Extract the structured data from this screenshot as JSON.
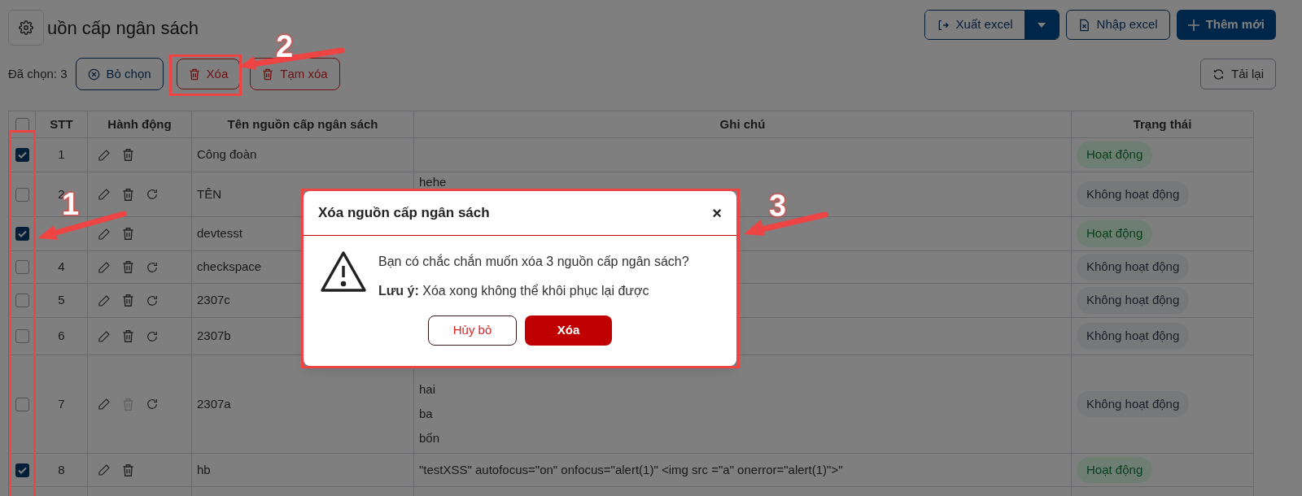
{
  "page": {
    "title": "uồn cấp ngân sách"
  },
  "toolbar": {
    "export": "Xuất excel",
    "import": "Nhập excel",
    "add": "Thêm mới",
    "reload": "Tải lại"
  },
  "selection": {
    "count_label": "Đã chọn: 3",
    "buttons": [
      {
        "label": "Bỏ chọn",
        "kind": "clear"
      },
      {
        "label": "Xóa",
        "kind": "delete"
      },
      {
        "label": "Tạm xóa",
        "kind": "soft-delete"
      }
    ]
  },
  "table": {
    "header_checked": false,
    "columns": [
      "STT",
      "Hành động",
      "Tên nguồn cấp ngân sách",
      "Ghi chú",
      "Trạng thái"
    ],
    "rows": [
      {
        "checked": true,
        "stt": "1",
        "name": "Công đoàn",
        "can_restore": false,
        "delete_disabled": false,
        "status": {
          "label": "Hoạt động",
          "active": true
        }
      },
      {
        "checked": false,
        "stt": "2",
        "name": "TÊN",
        "note": [
          "hehe"
        ],
        "can_restore": true,
        "delete_disabled": false,
        "status": {
          "label": "Không hoạt động",
          "active": false
        }
      },
      {
        "checked": true,
        "name": "devtesst",
        "can_restore": false,
        "delete_disabled": false,
        "status": {
          "label": "Hoạt động",
          "active": true
        }
      },
      {
        "checked": false,
        "stt": "4",
        "name": "checkspace",
        "can_restore": true,
        "delete_disabled": false,
        "status": {
          "label": "Không hoạt động",
          "active": false
        }
      },
      {
        "checked": false,
        "stt": "5",
        "name": "2307c",
        "can_restore": true,
        "delete_disabled": false,
        "status": {
          "label": "Không hoạt động",
          "active": false
        }
      },
      {
        "checked": false,
        "stt": "6",
        "name": "2307b",
        "can_restore": true,
        "delete_disabled": false,
        "status": {
          "label": "Không hoạt động",
          "active": false
        }
      },
      {
        "checked": false,
        "stt": "7",
        "name": "2307a",
        "note": [
          "hai",
          "ba",
          "bốn"
        ],
        "can_restore": true,
        "delete_disabled": true,
        "status": {
          "label": "Không hoạt động",
          "active": false
        }
      },
      {
        "checked": true,
        "stt": "8",
        "name": "hb",
        "note": [
          "\"testXSS\" autofocus=\"on\" onfocus=\"alert(1)\" <img src =\"a\" onerror=\"alert(1)\">\""
        ],
        "can_restore": false,
        "delete_disabled": false,
        "status": {
          "label": "Hoạt động",
          "active": true
        }
      }
    ]
  },
  "dialog": {
    "title": "Xóa nguồn cấp ngân sách",
    "close": "×",
    "message": "Bạn có chắc chắn muốn xóa 3 nguồn cấp ngân sách?",
    "note": "**Lưu ý:** Xóa xong không thể khôi phục lại được",
    "buttons": [
      {
        "label": "Hủy bỏ",
        "kind": "cancel"
      },
      {
        "label": "Xóa",
        "kind": "confirm"
      }
    ]
  },
  "annotations": [
    {
      "label": "1"
    },
    {
      "label": "2"
    },
    {
      "label": "3"
    }
  ]
}
